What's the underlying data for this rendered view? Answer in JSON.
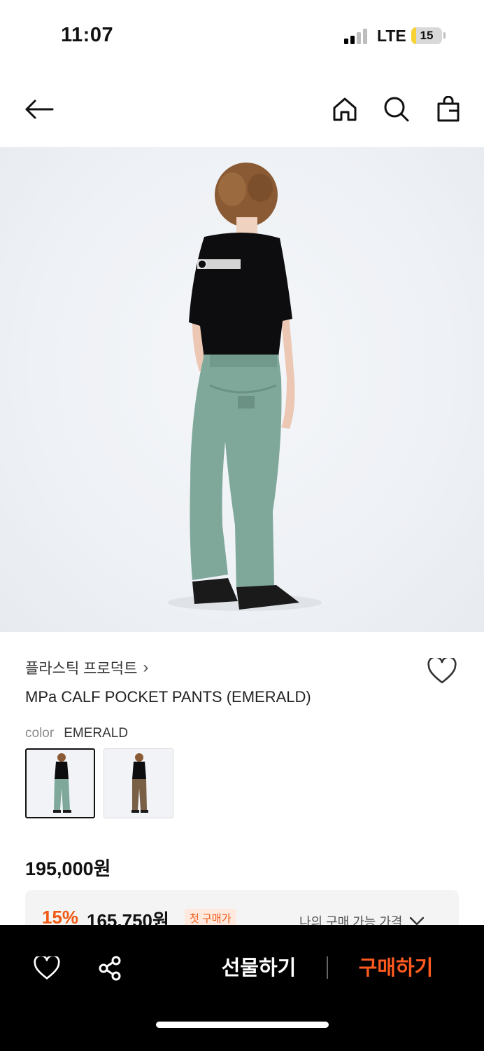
{
  "status_bar": {
    "time": "11:07",
    "network": "LTE",
    "battery": "15",
    "battery_fraction": 0.15
  },
  "nav": {
    "icons": [
      "back-arrow-icon",
      "home-icon",
      "search-icon",
      "shopping-bag-icon"
    ]
  },
  "product": {
    "brand": "플라스틱 프로덕트",
    "brand_chevron": "›",
    "name": "MPa CALF POCKET PANTS (EMERALD)",
    "color_label": "color",
    "color_value": "EMERALD",
    "price": "195,000원",
    "colors": {
      "shirt": "#0d0d0f",
      "pants_emerald": "#7fa89a",
      "pants_brown": "#7a5f47",
      "hair": "#8a5a34"
    }
  },
  "discount": {
    "percent": "15%",
    "price": "165,750원",
    "badge": "첫 구매가",
    "link": "나의 구매 가능 가격"
  },
  "bottom_bar": {
    "gift_label": "선물하기",
    "buy_label": "구매하기",
    "accent": "#ff5a1f"
  }
}
